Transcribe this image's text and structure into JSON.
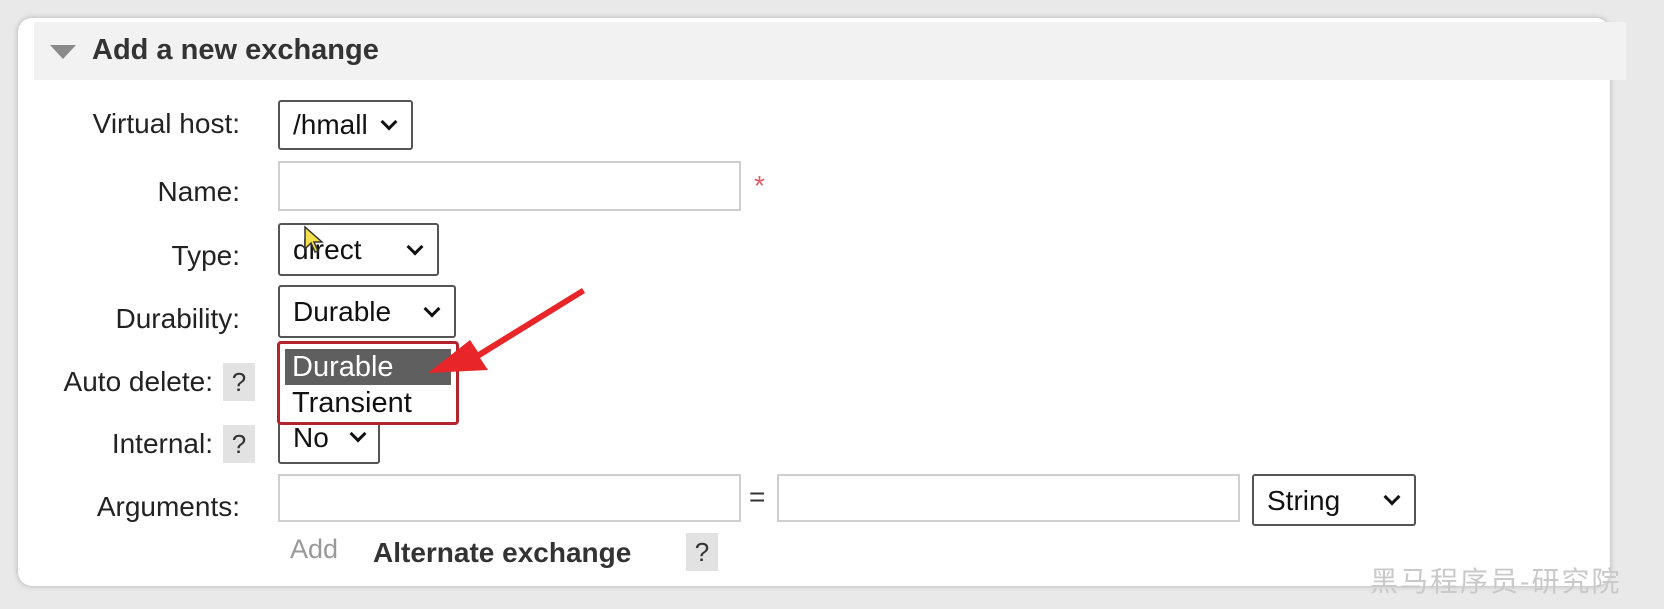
{
  "section": {
    "title": "Add a new exchange"
  },
  "form": {
    "virtual_host": {
      "label": "Virtual host:",
      "value": "/hmall"
    },
    "name": {
      "label": "Name:",
      "value": "",
      "required_mark": "*"
    },
    "type": {
      "label": "Type:",
      "value": "direct"
    },
    "durability": {
      "label": "Durability:",
      "value": "Durable",
      "options": [
        "Durable",
        "Transient"
      ],
      "highlighted_option": "Durable"
    },
    "auto_delete": {
      "label": "Auto delete:",
      "help": "?"
    },
    "internal": {
      "label": "Internal:",
      "help": "?",
      "value": "No"
    },
    "arguments": {
      "label": "Arguments:",
      "key_value": "",
      "equals": "=",
      "value": "",
      "type_value": "String"
    },
    "add_link": "Add",
    "alternate_exchange": {
      "label": "Alternate exchange",
      "help": "?"
    }
  },
  "watermark": "黑马程序员-研究院",
  "colors": {
    "dropdown_border": "#b3242f",
    "selected_option_bg": "#5f5f5f",
    "required_mark": "#e05a6a",
    "annotation_arrow": "#e8262a"
  }
}
